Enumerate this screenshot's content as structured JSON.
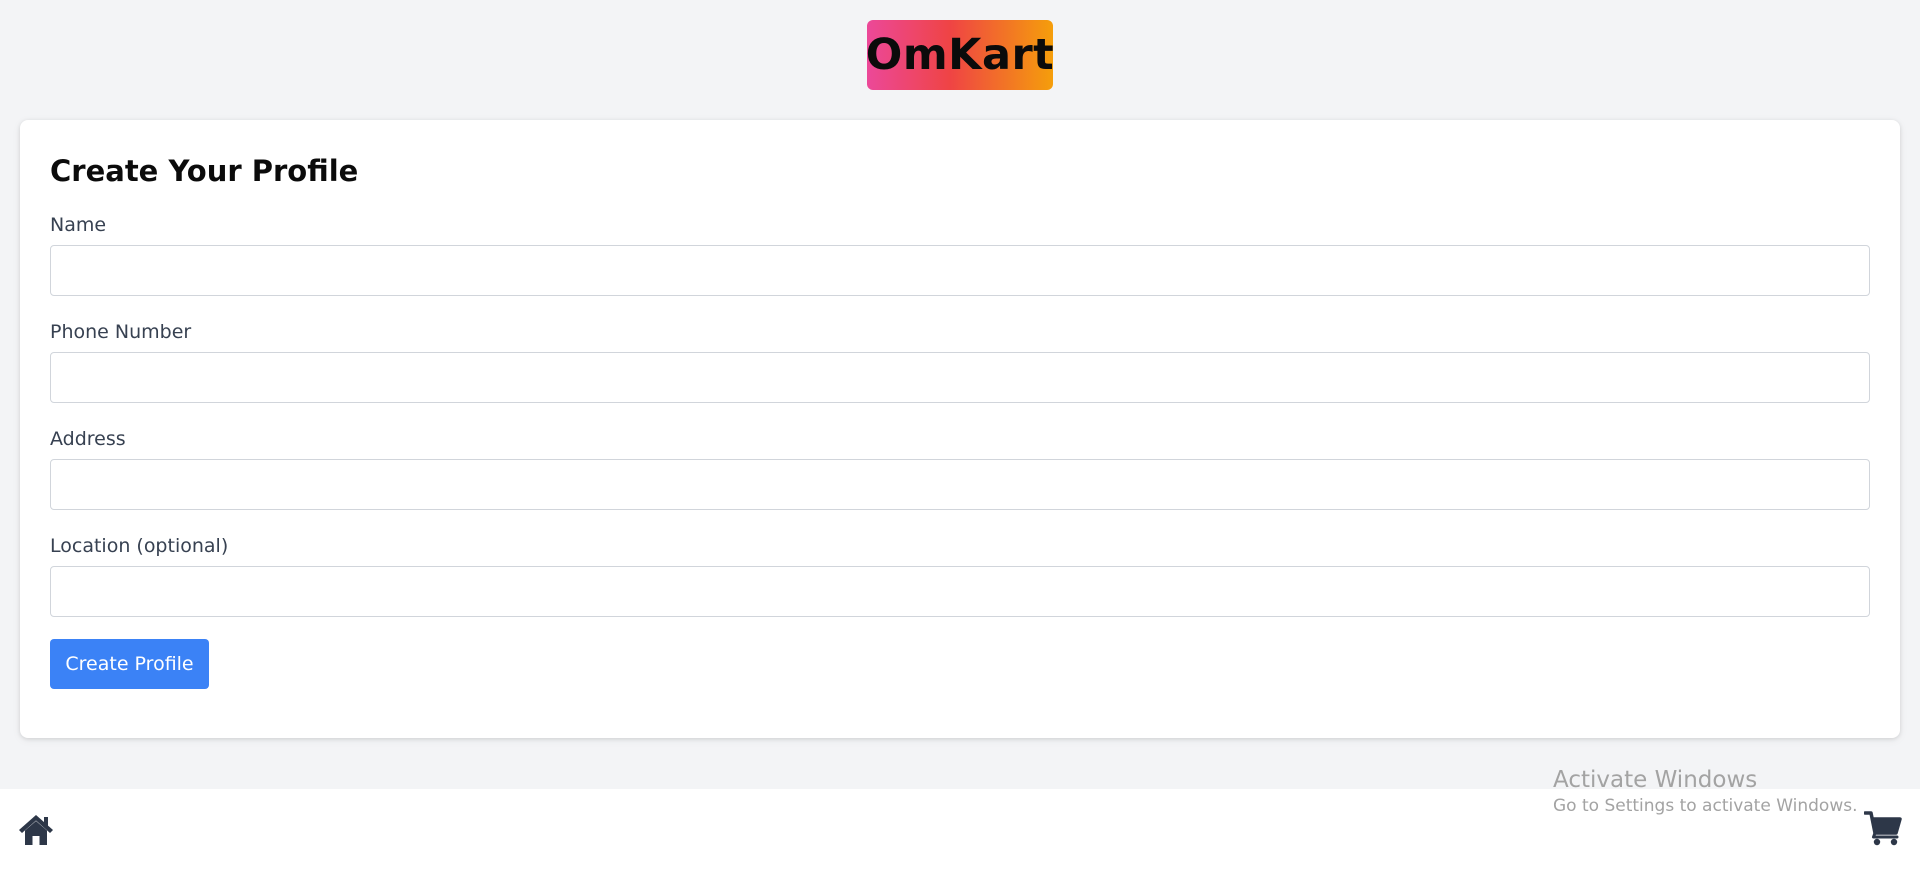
{
  "header": {
    "logo_text": "OmKart"
  },
  "form": {
    "title": "Create Your Profile",
    "fields": [
      {
        "label": "Name",
        "value": "",
        "placeholder": ""
      },
      {
        "label": "Phone Number",
        "value": "",
        "placeholder": ""
      },
      {
        "label": "Address",
        "value": "",
        "placeholder": ""
      },
      {
        "label": "Location (optional)",
        "value": "",
        "placeholder": ""
      }
    ],
    "submit_label": "Create Profile"
  },
  "bottom_nav": {
    "home_icon": "home-icon",
    "cart_icon": "cart-icon"
  },
  "watermark": {
    "title": "Activate Windows",
    "subtitle": "Go to Settings to activate Windows."
  },
  "colors": {
    "page_background": "#f3f4f6",
    "primary_button": "#3b82f6",
    "logo_gradient_start": "#ec4899",
    "logo_gradient_mid": "#ef4444",
    "logo_gradient_end": "#f59e0b",
    "icon_color": "#2d3748"
  }
}
